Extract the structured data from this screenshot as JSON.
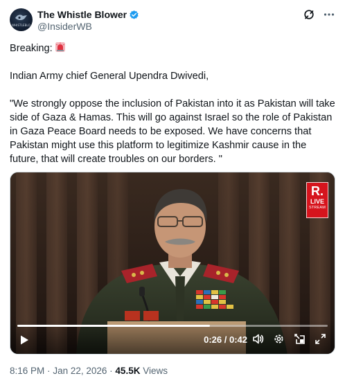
{
  "tweet": {
    "author": {
      "display_name": "The Whistle Blower",
      "handle": "@InsiderWB",
      "verified_icon": "verified-badge-icon",
      "verified_color": "#1d9bf0",
      "avatar_text": "WHISTLEBLOWER"
    },
    "header_actions": [
      "grok-icon",
      "more-options-icon"
    ],
    "lines": {
      "breaking": "Breaking:",
      "intro": "Indian Army chief General Upendra Dwivedi,",
      "quote": "\"We strongly oppose the inclusion of Pakistan into it as Pakistan will take side of Gaza & Hamas. This will go against Israel so the role of Pakistan in Gaza Peace Board needs to be exposed. We have concerns that Pakistan might use this platform to legitimize Kashmir cause in the future, that will create troubles on our borders. \""
    },
    "breaking_emoji": "rotating-light-icon",
    "video": {
      "logo_r": "R.",
      "logo_live": "LIVE",
      "logo_stream": "STREAM",
      "time_display": "0:26 / 0:42",
      "progress_fraction": 0.62,
      "controls": [
        "play-icon",
        "volume-icon",
        "settings-icon",
        "pip-icon",
        "fullscreen-icon"
      ]
    },
    "meta": {
      "time": "8:16 PM",
      "separator": "·",
      "date": "Jan 22, 2026",
      "views_count": "45.5K",
      "views_label": "Views"
    }
  }
}
